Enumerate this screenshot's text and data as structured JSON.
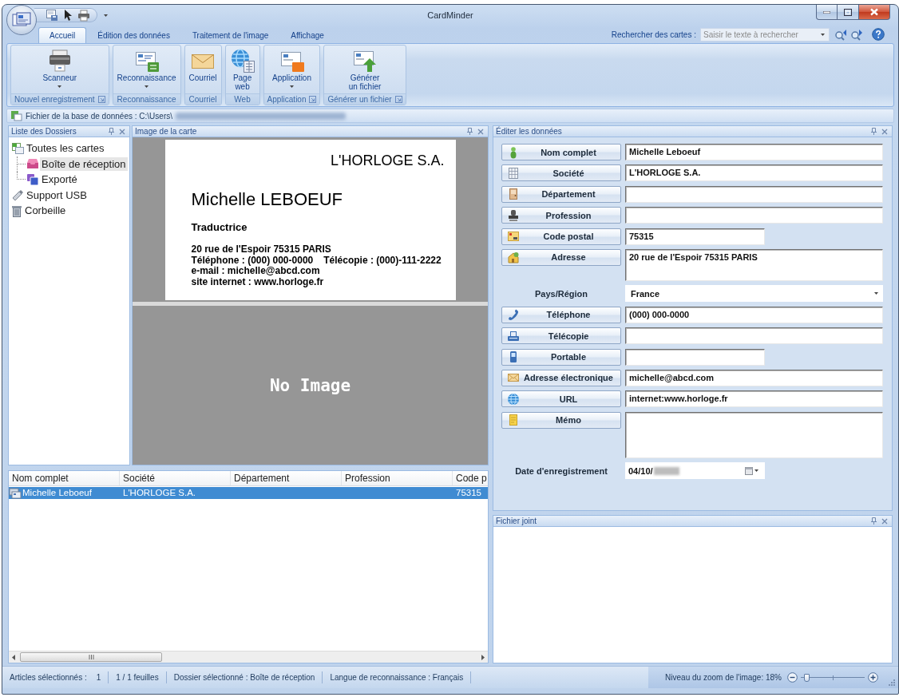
{
  "window": {
    "title": "CardMinder"
  },
  "ribbon": {
    "tabs": [
      {
        "label": "Accueil",
        "selected": true
      },
      {
        "label": "Édition des données",
        "selected": false
      },
      {
        "label": "Traitement de l'image",
        "selected": false
      },
      {
        "label": "Affichage",
        "selected": false
      }
    ],
    "search": {
      "label": "Rechercher des cartes :",
      "placeholder": "Saisir le texte à rechercher"
    },
    "groups": [
      {
        "label": "Nouvel enregistrement",
        "launcher": true,
        "buttons": [
          {
            "lines": [
              "Scanneur"
            ],
            "dropdown": true
          }
        ]
      },
      {
        "label": "Reconnaissance",
        "launcher": false,
        "buttons": [
          {
            "lines": [
              "Reconnaissance"
            ],
            "dropdown": true
          }
        ]
      },
      {
        "label": "Courriel",
        "launcher": false,
        "buttons": [
          {
            "lines": [
              "Courriel"
            ],
            "dropdown": false
          }
        ]
      },
      {
        "label": "Web",
        "launcher": false,
        "buttons": [
          {
            "lines": [
              "Page",
              "web"
            ],
            "dropdown": false
          }
        ]
      },
      {
        "label": "Application",
        "launcher": true,
        "buttons": [
          {
            "lines": [
              "Application"
            ],
            "dropdown": true
          }
        ]
      },
      {
        "label": "Générer un fichier",
        "launcher": true,
        "buttons": [
          {
            "lines": [
              "Générer",
              "un fichier"
            ],
            "dropdown": false
          }
        ]
      }
    ]
  },
  "database_bar": {
    "label": "Fichier de la base de données : C:\\Users\\"
  },
  "folders_panel": {
    "title": "Liste des Dossiers",
    "items": [
      {
        "kind": "cards",
        "label": "Toutes les cartes",
        "selected": false,
        "children": [
          {
            "kind": "inbox",
            "label": "Boîte de réception",
            "selected": true
          },
          {
            "kind": "exported",
            "label": "Exporté",
            "selected": false
          }
        ]
      },
      {
        "kind": "usb",
        "label": "Support USB",
        "selected": false
      },
      {
        "kind": "trash",
        "label": "Corbeille",
        "selected": false
      }
    ]
  },
  "card_panel": {
    "title": "Image de la carte",
    "card": {
      "company": "L'HORLOGE S.A.",
      "name": "Michelle LEBOEUF",
      "job_title": "Traductrice",
      "lines": [
        [
          "20 rue de l'Espoir 75315 PARIS"
        ],
        [
          "Téléphone : (000) 000-0000",
          "Télécopie : (000)-111-2222"
        ],
        [
          "e-mail : michelle@abcd.com"
        ],
        [
          "site internet : www.horloge.fr"
        ]
      ]
    },
    "back_side": {
      "label": "No Image"
    }
  },
  "records_list": {
    "columns": [
      "Nom complet",
      "Société",
      "Département",
      "Profession",
      "Code p"
    ],
    "rows": [
      {
        "selected": true,
        "nom_complet": "Michelle Leboeuf",
        "societe": "L'HORLOGE S.A.",
        "column_5": "75315"
      }
    ]
  },
  "edit_panel": {
    "title": "Éditer les données",
    "fields": [
      {
        "kind": "text",
        "label": "Nom complet",
        "value": "Michelle Leboeuf"
      },
      {
        "kind": "text",
        "label": "Société",
        "value": "L'HORLOGE S.A."
      },
      {
        "kind": "text",
        "label": "Département"
      },
      {
        "kind": "text",
        "label": "Profession"
      },
      {
        "kind": "short",
        "label": "Code postal",
        "value": "75315"
      },
      {
        "kind": "multiline",
        "label": "Adresse",
        "value": "20 rue de l'Espoir 75315 PARIS"
      },
      {
        "kind": "select",
        "label": "Pays/Région",
        "value": "France"
      },
      {
        "kind": "text",
        "label": "Téléphone",
        "value": "(000) 000-0000"
      },
      {
        "kind": "text",
        "label": "Télécopie"
      },
      {
        "kind": "short",
        "label": "Portable"
      },
      {
        "kind": "text",
        "label": "Adresse électronique",
        "value": "michelle@abcd.com"
      },
      {
        "kind": "text",
        "label": "URL",
        "value": "internet:www.horloge.fr"
      },
      {
        "kind": "memo",
        "label": "Mémo"
      },
      {
        "kind": "date",
        "label": "Date d'enregistrement",
        "value": "04/10/"
      }
    ]
  },
  "attachment_panel": {
    "title": "Fichier joint"
  },
  "status_bar": {
    "sections": [
      [
        "Articles sélectionnés :",
        "1"
      ],
      [
        "1 / 1 feuilles"
      ],
      [
        "Dossier sélectionné : Boîte de réception"
      ],
      [
        "Langue de reconnaissance : Français"
      ]
    ],
    "zoom": {
      "label": "Niveau du zoom de l'image: 18%",
      "level": 0.05
    }
  }
}
